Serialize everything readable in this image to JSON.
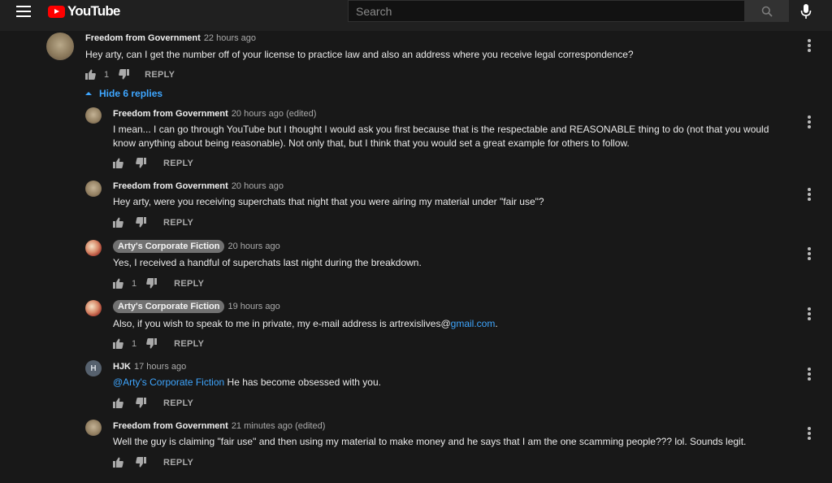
{
  "header": {
    "logo_text": "YouTube",
    "search_placeholder": "Search"
  },
  "colors": {
    "brand": "#ff0000",
    "link": "#3ea6ff",
    "background": "#181818"
  },
  "parent_comment": {
    "author": "Freedom from Government",
    "time": "22 hours ago",
    "text": "Hey arty, can I get the number off of your license to practice law and also an address where you receive legal correspondence?",
    "likes": "1",
    "reply_label": "REPLY"
  },
  "hide_replies_label": "Hide 6 replies",
  "replies": [
    {
      "author": "Freedom from Government",
      "time": "20 hours ago (edited)",
      "text": "I mean... I can go through YouTube but I thought I would ask you first because that is the respectable and REASONABLE thing to do (not that you would know anything about being reasonable). Not only that, but I think that you would set a great example for others to follow.",
      "likes": "",
      "reply_label": "REPLY"
    },
    {
      "author": "Freedom from Government",
      "time": "20 hours ago",
      "text": "Hey arty, were you receiving superchats that night that you were airing my material under \"fair use\"?",
      "likes": "",
      "reply_label": "REPLY"
    },
    {
      "author": "Arty's Corporate Fiction",
      "time": "20 hours ago",
      "text": "Yes, I received a handful of superchats last night during the breakdown.",
      "likes": "1",
      "reply_label": "REPLY"
    },
    {
      "author": "Arty's Corporate Fiction",
      "time": "19 hours ago",
      "text_before": "Also, if you wish to speak to me in private, my e-mail address is artrexislives@",
      "text_link": "gmail.com",
      "text_after": ".",
      "likes": "1",
      "reply_label": "REPLY"
    },
    {
      "author": "HJK",
      "avatar_letter": "H",
      "time": "17 hours ago",
      "mention": "@Arty's Corporate Fiction",
      "text": " He has become obsessed with you.",
      "likes": "",
      "reply_label": "REPLY"
    },
    {
      "author": "Freedom from Government",
      "time": "21 minutes ago (edited)",
      "text": "Well the guy is claiming \"fair use\" and then using my material to make money and he says that I am the one scamming people??? lol. Sounds legit.",
      "likes": "",
      "reply_label": "REPLY"
    }
  ]
}
